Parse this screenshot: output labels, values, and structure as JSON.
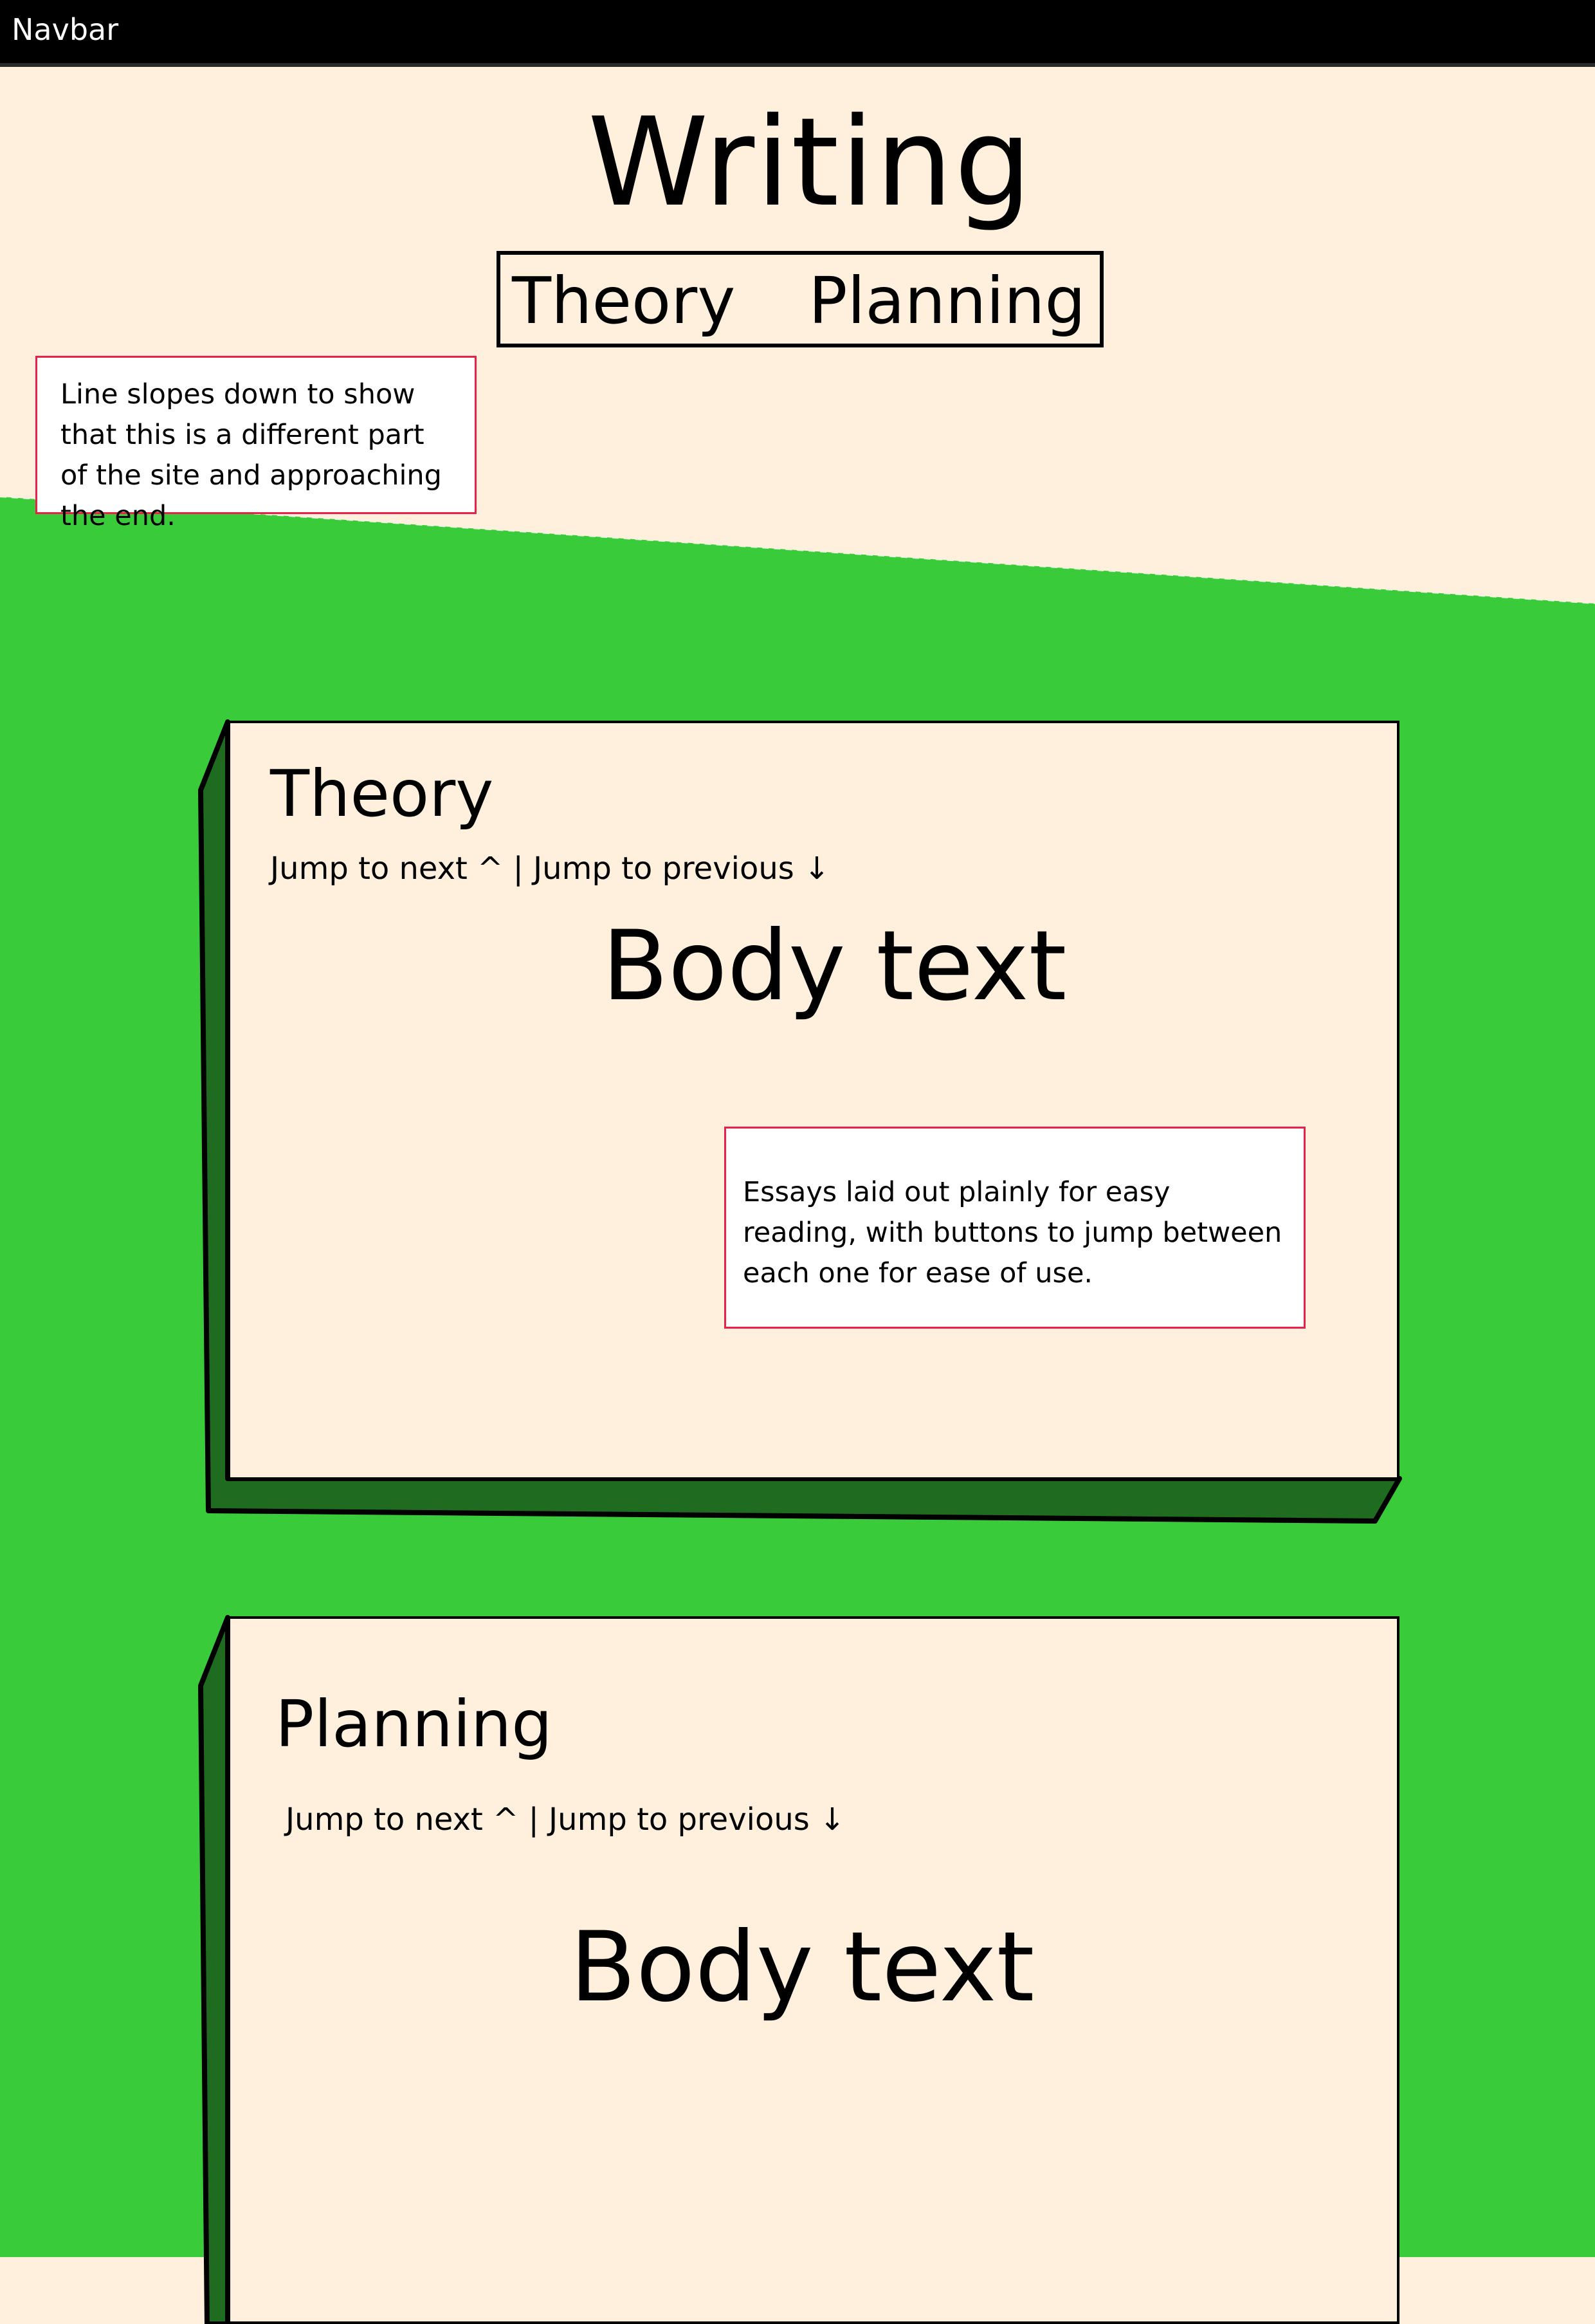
{
  "navbar": {
    "label": "Navbar"
  },
  "header": {
    "title": "Writing",
    "nav": [
      "Theory",
      "Planning"
    ]
  },
  "notes": {
    "slope": "Line slopes down to show that this is a different part of the site and approaching the end.",
    "essays": "Essays laid out plainly for easy reading, with buttons to jump between each one for ease of use."
  },
  "sections": [
    {
      "title": "Theory",
      "jump_next": "Jump to next ^",
      "separator": " | ",
      "jump_previous": "Jump to previous ↓",
      "body": "Body text"
    },
    {
      "title": "Planning",
      "jump_next": "Jump to next ^",
      "separator": " | ",
      "jump_previous": "Jump to previous ↓",
      "body": "Body text"
    }
  ],
  "colors": {
    "page_background": "#fff0de",
    "green": "#3acb3a",
    "card_shadow": "#1f6b1f",
    "note_border": "#e8204a",
    "navbar": "#000000"
  }
}
